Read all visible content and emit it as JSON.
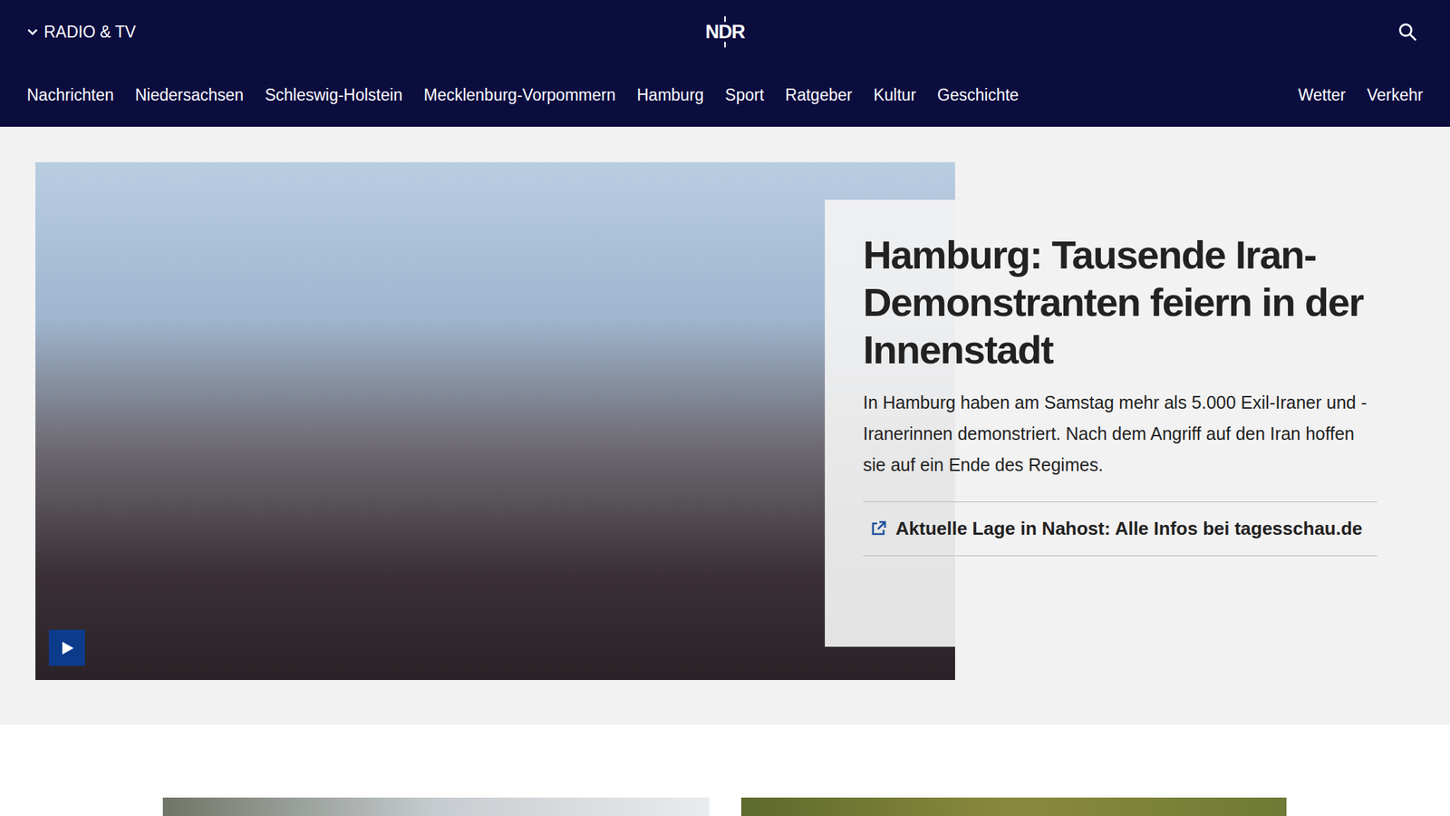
{
  "header": {
    "menu_label": "RADIO & TV",
    "logo": "NDR"
  },
  "nav": {
    "items": [
      "Nachrichten",
      "Niedersachsen",
      "Schleswig-Holstein",
      "Mecklenburg-Vorpommern",
      "Hamburg",
      "Sport",
      "Ratgeber",
      "Kultur",
      "Geschichte"
    ],
    "right_items": [
      "Wetter",
      "Verkehr"
    ]
  },
  "hero": {
    "title": "Hamburg: Tausende Iran-Demonstranten feiern in der Innenstadt",
    "teaser": "In Hamburg haben am Samstag mehr als 5.000 Exil-Iraner und -Iranerinnen demonstriert. Nach dem Angriff auf den Iran hoffen sie auf ein Ende des Regimes.",
    "link": "Aktuelle Lage in Nahost: Alle Infos bei tagesschau.de",
    "has_video": true
  },
  "teasers": [
    {
      "kind": "image"
    },
    {
      "kind": "image"
    }
  ]
}
